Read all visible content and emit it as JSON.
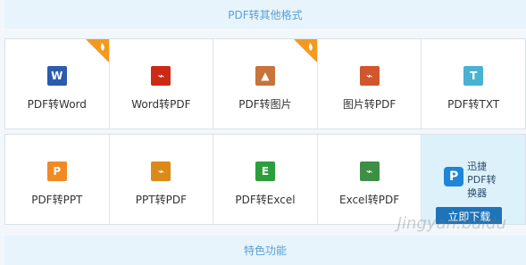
{
  "top_section": {
    "title": "PDF转其他格式"
  },
  "bottom_section": {
    "title": "特色功能"
  },
  "row1": [
    {
      "label": "PDF转Word",
      "icon": "W",
      "color": "#2b5cad",
      "hot": true
    },
    {
      "label": "Word转PDF",
      "icon": "⌁",
      "color": "#cc2a16",
      "hot": false
    },
    {
      "label": "PDF转图片",
      "icon": "▲",
      "color": "#c7733a",
      "hot": true
    },
    {
      "label": "图片转PDF",
      "icon": "⌁",
      "color": "#d1562d",
      "hot": false
    },
    {
      "label": "PDF转TXT",
      "icon": "T",
      "color": "#4ab1d2",
      "hot": false
    }
  ],
  "row2": [
    {
      "label": "PDF转PPT",
      "icon": "P",
      "color": "#f28a24"
    },
    {
      "label": "PPT转PDF",
      "icon": "⌁",
      "color": "#d98a18"
    },
    {
      "label": "PDF转Excel",
      "icon": "E",
      "color": "#2c9f3c"
    },
    {
      "label": "Excel转PDF",
      "icon": "⌁",
      "color": "#3e8f45"
    }
  ],
  "promo": {
    "name_line1": "迅捷",
    "name_line2": "PDF转",
    "name_line3": "换器",
    "download": "立即下载",
    "logo": "P"
  },
  "watermark": "Jingyan.baidu"
}
